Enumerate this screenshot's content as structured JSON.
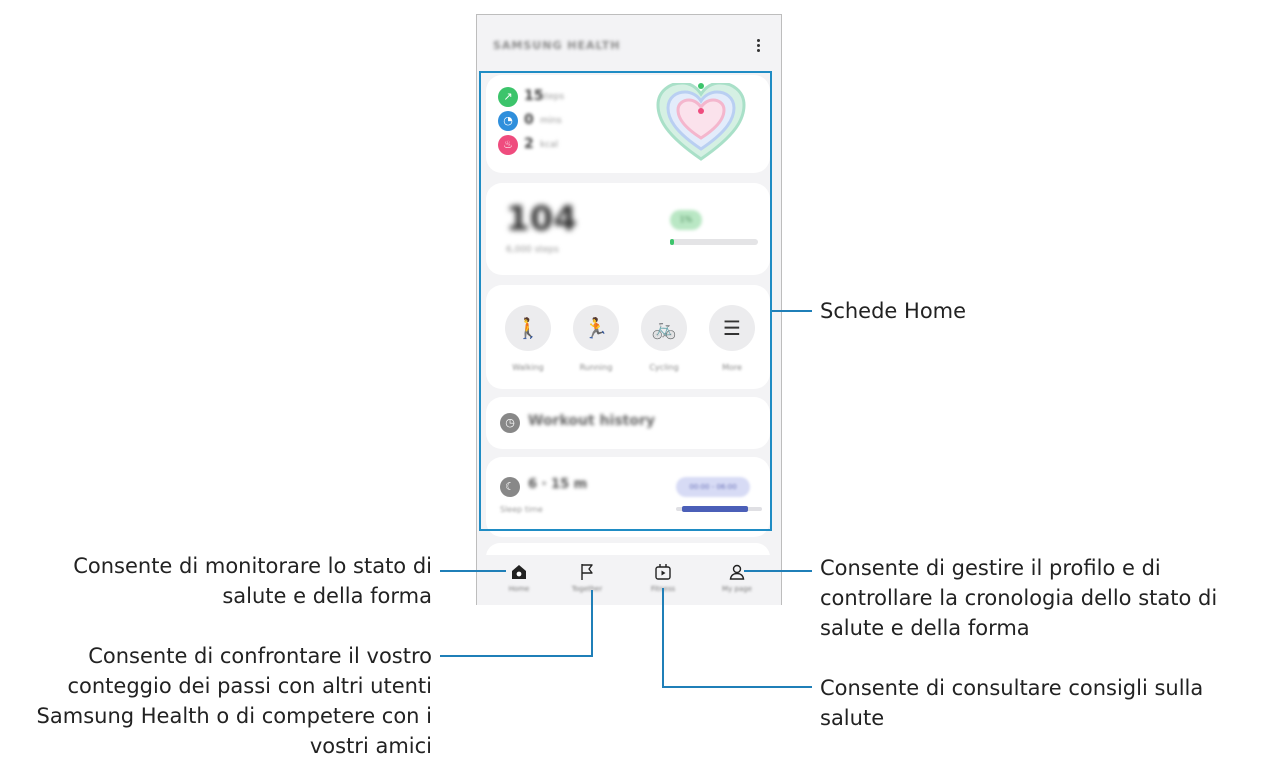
{
  "phone": {
    "app_title": "SAMSUNG HEALTH",
    "stats": [
      {
        "icon": "footprints-icon",
        "value": "15",
        "unit": "steps",
        "color": "#3cc46b"
      },
      {
        "icon": "clock-icon",
        "value": "0",
        "unit": "mins",
        "color": "#2f8fdc"
      },
      {
        "icon": "flame-icon",
        "value": "2",
        "unit": "kcal",
        "color": "#ef4c7e"
      }
    ],
    "steps": {
      "value": "104",
      "label": "6,000 steps",
      "goal_pill": "1%",
      "progress": 0.04
    },
    "activities": [
      {
        "icon": "walking-icon",
        "glyph": "🚶",
        "label": "Walking"
      },
      {
        "icon": "running-icon",
        "glyph": "🏃",
        "label": "Running"
      },
      {
        "icon": "cycling-icon",
        "glyph": "🚲",
        "label": "Cycling"
      },
      {
        "icon": "list-icon",
        "glyph": "☰",
        "label": "More"
      }
    ],
    "history": {
      "label": "Workout history"
    },
    "sleep": {
      "value": "6 · 15 m",
      "label": "Sleep time",
      "bubble": "00:00 - 06:00"
    },
    "nav": [
      {
        "icon": "home-icon",
        "label": "Home"
      },
      {
        "icon": "flag-icon",
        "label": "Together"
      },
      {
        "icon": "fitness-icon",
        "label": "Fitness"
      },
      {
        "icon": "profile-icon",
        "label": "My page"
      }
    ]
  },
  "callouts": {
    "home_cards": "Schede Home",
    "home_desc_1": "Consente di monitorare lo stato di",
    "home_desc_2": "salute e della forma",
    "together_1": "Consente di confrontare il vostro",
    "together_2": "conteggio dei passi con altri utenti",
    "together_3": "Samsung Health o di competere con i",
    "together_4": "vostri amici",
    "profile_1": "Consente di gestire il profilo e di",
    "profile_2": "controllare la cronologia dello stato di",
    "profile_3": "salute e della forma",
    "fitness_1": "Consente di consultare consigli sulla",
    "fitness_2": "salute"
  },
  "colors": {
    "accent": "#1f8cc4",
    "green": "#3cc46b",
    "blue": "#2f8fdc",
    "pink": "#ef4c7e",
    "sleep": "#4b5fb8"
  }
}
